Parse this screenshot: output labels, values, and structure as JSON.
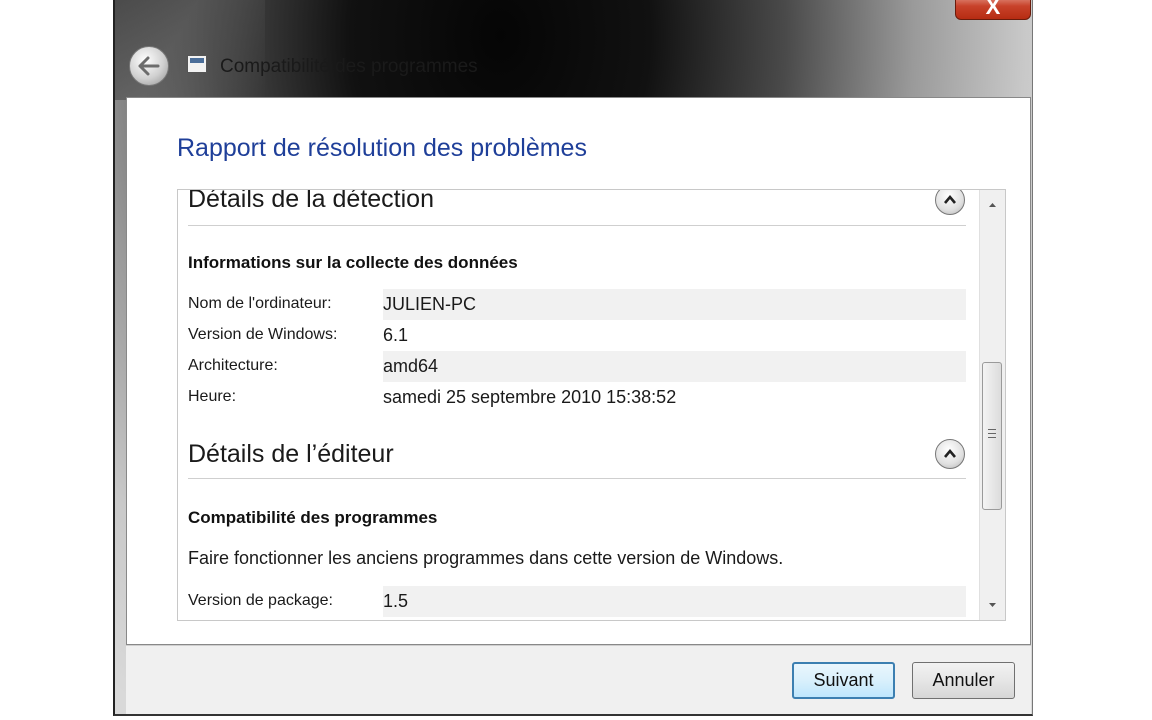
{
  "window": {
    "title": "Compatibilité des programmes",
    "close_label": "X"
  },
  "page_heading": "Rapport de résolution des problèmes",
  "detection": {
    "title": "Détails de la détection",
    "subhead": "Informations sur la collecte des données",
    "rows": [
      {
        "label": "Nom de l'ordinateur:",
        "value": "JULIEN-PC"
      },
      {
        "label": "Version de Windows:",
        "value": "6.1"
      },
      {
        "label": "Architecture:",
        "value": "amd64"
      },
      {
        "label": "Heure:",
        "value": "samedi 25 septembre 2010 15:38:52"
      }
    ]
  },
  "publisher": {
    "title": "Détails de l’éditeur",
    "subhead": "Compatibilité des programmes",
    "description": "Faire fonctionner les anciens programmes dans cette version de Windows.",
    "rows": [
      {
        "label": "Version de package:",
        "value": "1.5"
      }
    ]
  },
  "icons": {
    "back": "back-arrow-icon",
    "app": "program-compatibility-icon",
    "collapse": "chevron-up-icon",
    "scroll_up": "scroll-up-arrow-icon",
    "scroll_down": "scroll-down-arrow-icon"
  },
  "buttons": {
    "next": "Suivant",
    "cancel": "Annuler"
  }
}
